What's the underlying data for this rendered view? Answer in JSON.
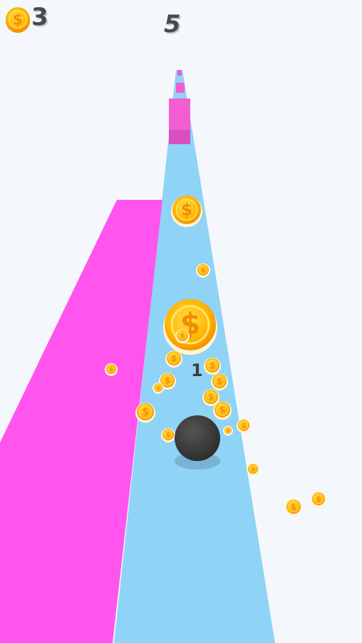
{
  "hud": {
    "coin_count": "3",
    "level": "5",
    "floating_count": "1"
  },
  "colors": {
    "background": "#f4f8fc",
    "track": "#8fd3f7",
    "wall": "#ff55ee",
    "obstacle": "#f25ed2",
    "ball": "#3b3b3b",
    "coin_gold": "#ffa800",
    "coin_face": "#ffd21e",
    "hud_text": "#4a4a4a"
  },
  "icons": {
    "coin": "dollar-coin-icon"
  },
  "scene": {
    "player": "ball",
    "track": "light-blue-road",
    "obstacles": [
      "pink-wall-left",
      "pink-blocks-ahead"
    ]
  }
}
